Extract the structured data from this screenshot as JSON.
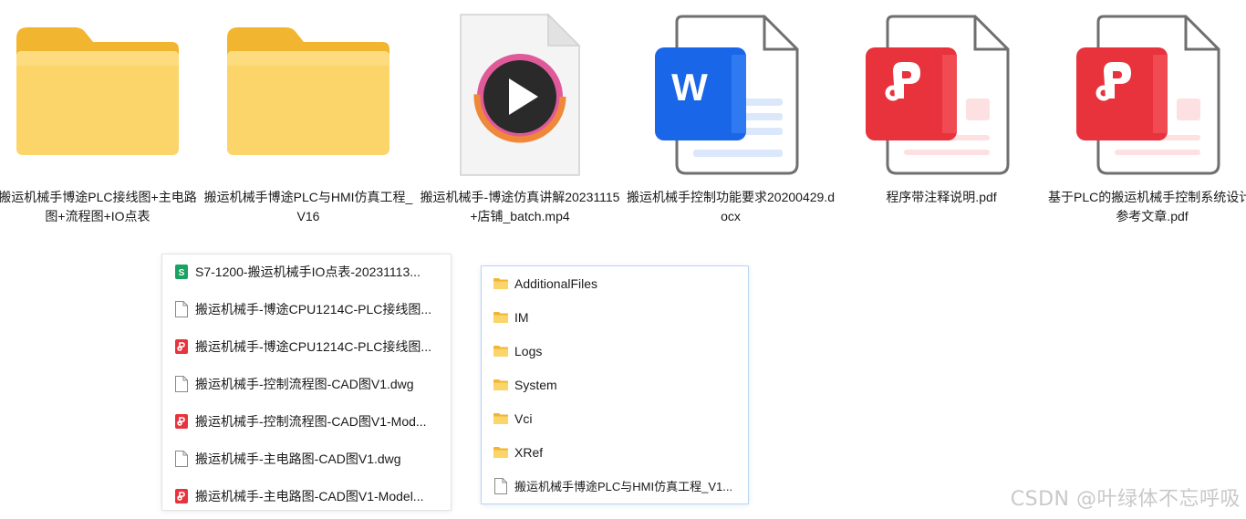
{
  "tiles": [
    {
      "icon": "folder-icon",
      "name": "搬运机械手博途PLC接线图+主电路图+流程图+IO点表"
    },
    {
      "icon": "folder-icon",
      "name": "搬运机械手博途PLC与HMI仿真工程_V16"
    },
    {
      "icon": "video-file-icon",
      "name": "搬运机械手-博途仿真讲解20231115+店铺_batch.mp4"
    },
    {
      "icon": "word-document-icon",
      "name": "搬运机械手控制功能要求20200429.docx"
    },
    {
      "icon": "pdf-document-icon",
      "name": "程序带注释说明.pdf"
    },
    {
      "icon": "pdf-document-icon",
      "name": "基于PLC的搬运机械手控制系统设计-参考文章.pdf"
    }
  ],
  "left_panel": {
    "items": [
      {
        "icon": "spreadsheet-icon",
        "label": "S7-1200-搬运机械手IO点表-20231113..."
      },
      {
        "icon": "blank-file-icon",
        "label": "搬运机械手-博途CPU1214C-PLC接线图..."
      },
      {
        "icon": "pdf-file-icon",
        "label": "搬运机械手-博途CPU1214C-PLC接线图..."
      },
      {
        "icon": "blank-file-icon",
        "label": "搬运机械手-控制流程图-CAD图V1.dwg"
      },
      {
        "icon": "pdf-file-icon",
        "label": "搬运机械手-控制流程图-CAD图V1-Mod..."
      },
      {
        "icon": "blank-file-icon",
        "label": "搬运机械手-主电路图-CAD图V1.dwg"
      },
      {
        "icon": "pdf-file-icon",
        "label": "搬运机械手-主电路图-CAD图V1-Model..."
      }
    ]
  },
  "right_panel": {
    "items": [
      {
        "icon": "folder-icon",
        "label": "AdditionalFiles"
      },
      {
        "icon": "folder-icon",
        "label": "IM"
      },
      {
        "icon": "folder-icon",
        "label": "Logs"
      },
      {
        "icon": "folder-icon",
        "label": "System"
      },
      {
        "icon": "folder-icon",
        "label": "Vci"
      },
      {
        "icon": "folder-icon",
        "label": "XRef"
      },
      {
        "icon": "blank-file-icon",
        "label": "搬运机械手博途PLC与HMI仿真工程_V1..."
      }
    ]
  },
  "watermark": "CSDN @叶绿体不忘呼吸",
  "colors": {
    "folder": "#f7c948",
    "word": "#1a66e8",
    "pdf": "#e8323c",
    "spreadsheet": "#1aa260",
    "panel_border_blue": "#b8d4f2"
  }
}
